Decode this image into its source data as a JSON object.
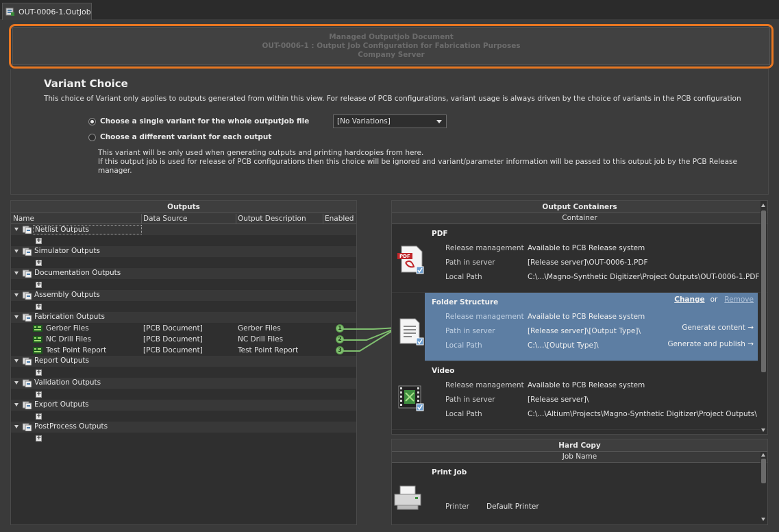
{
  "tab": {
    "title": "OUT-0006-1.OutJob"
  },
  "managed": {
    "line1": "Managed Outputjob Document",
    "line2": "OUT-0006-1 : Output Job Configuration for Fabrication Purposes",
    "line3": "Company Server"
  },
  "variant": {
    "title": "Variant Choice",
    "description": "This choice of Variant only applies to outputs generated from within this view. For release of PCB configurations, variant usage is always driven by the choice of variants in the PCB configuration",
    "option_single": "Choose a single variant for the whole outputjob file",
    "option_each": "Choose a different variant for each output",
    "dropdown_value": "[No Variations]",
    "note1": "This variant will be only used when generating outputs and printing hardcopies from here.",
    "note2": "If this output job is used for release of PCB configurations then this choice will be ignored and variant/parameter information will be passed to this output job by the PCB Release manager."
  },
  "outputs": {
    "title": "Outputs",
    "columns": [
      "Name",
      "Data Source",
      "Output Description",
      "Enabled"
    ],
    "groups": [
      {
        "label": "Netlist Outputs"
      },
      {
        "label": "Simulator Outputs"
      },
      {
        "label": "Documentation Outputs"
      },
      {
        "label": "Assembly Outputs"
      },
      {
        "label": "Fabrication Outputs"
      },
      {
        "label": "Report Outputs"
      },
      {
        "label": "Validation Outputs"
      },
      {
        "label": "Export Outputs"
      },
      {
        "label": "PostProcess Outputs"
      }
    ],
    "fabrication_items": [
      {
        "name": "Gerber Files",
        "source": "[PCB Document]",
        "desc": "Gerber Files",
        "enabled": "1"
      },
      {
        "name": "NC Drill Files",
        "source": "[PCB Document]",
        "desc": "NC Drill Files",
        "enabled": "2"
      },
      {
        "name": "Test Point Report",
        "source": "[PCB Document]",
        "desc": "Test Point Report",
        "enabled": "3"
      }
    ]
  },
  "containers": {
    "title": "Output Containers",
    "column": "Container",
    "labels": {
      "release": "Release management",
      "path_server": "Path in server",
      "local_path": "Local Path"
    },
    "items": [
      {
        "name": "PDF",
        "release": "Available to PCB Release system",
        "path_server": "[Release server]\\OUT-0006-1.PDF",
        "local_path": "C:\\...\\Magno-Synthetic Digitizer\\Project Outputs\\OUT-0006-1.PDF"
      },
      {
        "name": "Folder Structure",
        "release": "Available to PCB Release system",
        "path_server": "[Release server]\\[Output Type]\\",
        "local_path": "C:\\...\\[Output Type]\\"
      },
      {
        "name": "Video",
        "release": "Available to PCB Release system",
        "path_server": "[Release server]\\",
        "local_path": "C:\\...\\Altium\\Projects\\Magno-Synthetic Digitizer\\Project Outputs\\"
      }
    ],
    "change": "Change",
    "or": "or",
    "remove": "Remove",
    "generate_content": "Generate content →",
    "generate_publish": "Generate and publish →"
  },
  "hardcopy": {
    "title": "Hard Copy",
    "column": "Job Name",
    "job": "Print Job",
    "printer_label": "Printer",
    "printer_value": "Default Printer"
  }
}
